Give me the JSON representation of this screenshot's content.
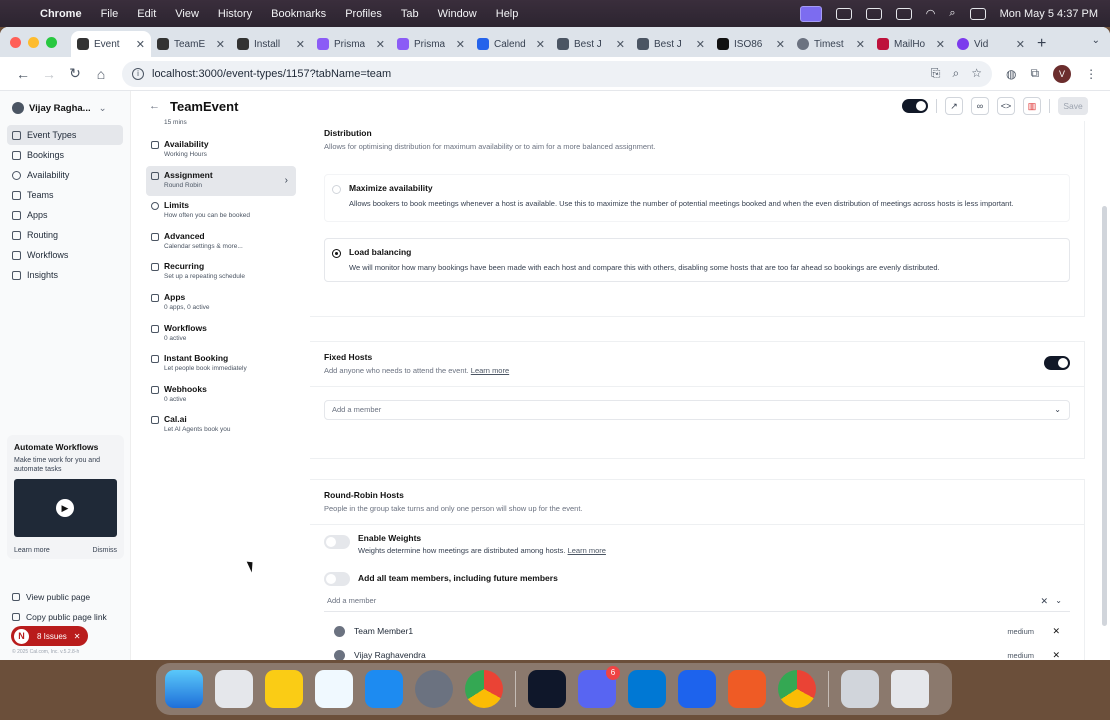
{
  "menubar": {
    "app": "Chrome",
    "items": [
      "File",
      "Edit",
      "View",
      "History",
      "Bookmarks",
      "Profiles",
      "Tab",
      "Window",
      "Help"
    ],
    "datetime": "Mon May 5  4:37 PM"
  },
  "tabs": [
    {
      "label": "Event",
      "active": true
    },
    {
      "label": "TeamE"
    },
    {
      "label": "Install"
    },
    {
      "label": "Prisma"
    },
    {
      "label": "Prisma"
    },
    {
      "label": "Calend"
    },
    {
      "label": "Best J"
    },
    {
      "label": "Best J"
    },
    {
      "label": "ISO86"
    },
    {
      "label": "Timest"
    },
    {
      "label": "MailHo"
    },
    {
      "label": "Vid"
    }
  ],
  "address": {
    "url": "localhost:3000/event-types/1157?tabName=team"
  },
  "profile_initial": "V",
  "sidebar": {
    "user_name": "Vijay Ragha...",
    "items": [
      {
        "label": "Event Types",
        "active": true
      },
      {
        "label": "Bookings"
      },
      {
        "label": "Availability"
      },
      {
        "label": "Teams"
      },
      {
        "label": "Apps"
      },
      {
        "label": "Routing"
      },
      {
        "label": "Workflows"
      },
      {
        "label": "Insights"
      }
    ],
    "promo": {
      "title": "Automate Workflows",
      "desc": "Make time work for you and automate tasks",
      "learn_more": "Learn more",
      "dismiss": "Dismiss"
    },
    "view_public": "View public page",
    "copy_public": "Copy public page link",
    "issues_initial": "N",
    "issues_label": "8 Issues",
    "footnote": "© 2025 Cal.com, Inc. v.5.2.8-h"
  },
  "header": {
    "title": "TeamEvent",
    "save_label": "Save"
  },
  "subnav": {
    "first_desc": "15 mins",
    "items": [
      {
        "title": "Availability",
        "desc": "Working Hours"
      },
      {
        "title": "Assignment",
        "desc": "Round Robin",
        "active": true
      },
      {
        "title": "Limits",
        "desc": "How often you can be booked"
      },
      {
        "title": "Advanced",
        "desc": "Calendar settings & more..."
      },
      {
        "title": "Recurring",
        "desc": "Set up a repeating schedule"
      },
      {
        "title": "Apps",
        "desc": "0 apps, 0 active"
      },
      {
        "title": "Workflows",
        "desc": "0 active"
      },
      {
        "title": "Instant Booking",
        "desc": "Let people book immediately"
      },
      {
        "title": "Webhooks",
        "desc": "0 active"
      },
      {
        "title": "Cal.ai",
        "desc": "Let AI Agents book you"
      }
    ]
  },
  "distribution": {
    "title": "Distribution",
    "desc": "Allows for optimising distribution for maximum availability or to aim for a more balanced assignment.",
    "options": [
      {
        "title": "Maximize availability",
        "desc": "Allows bookers to book meetings whenever a host is available. Use this to maximize the number of potential meetings booked and when the even distribution of meetings across hosts is less important.",
        "selected": false
      },
      {
        "title": "Load balancing",
        "desc": "We will monitor how many bookings have been made with each host and compare this with others, disabling some hosts that are too far ahead so bookings are evenly distributed.",
        "selected": true
      }
    ]
  },
  "fixed_hosts": {
    "title": "Fixed Hosts",
    "desc": "Add anyone who needs to attend the event.",
    "learn_more": "Learn more",
    "enabled": true,
    "placeholder": "Add a member"
  },
  "round_robin": {
    "title": "Round-Robin Hosts",
    "desc": "People in the group take turns and only one person will show up for the event.",
    "weights_title": "Enable Weights",
    "weights_desc": "Weights determine how meetings are distributed among hosts.",
    "weights_learn": "Learn more",
    "add_all_label": "Add all team members, including future members",
    "placeholder": "Add a member",
    "hosts": [
      {
        "name": "Team Member1",
        "priority": "medium"
      },
      {
        "name": "Vijay Raghavendra",
        "priority": "medium"
      }
    ]
  },
  "dock": {
    "discord_badge": "6"
  },
  "colors": {
    "accent": "#111827",
    "danger": "#b91c1c"
  }
}
